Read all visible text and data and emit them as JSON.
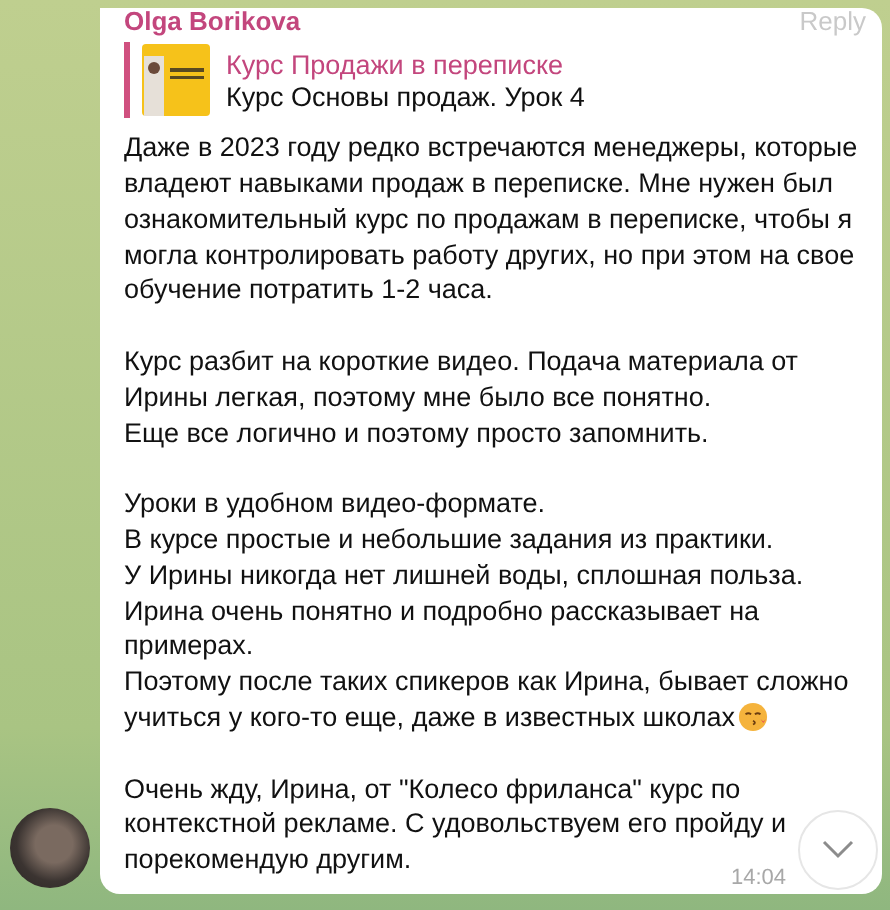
{
  "message": {
    "author": "Olga Borikova",
    "reply_action": "Reply",
    "quote": {
      "title": "Курс Продажи в переписке",
      "text": "Курс Основы продаж. Урок 4"
    },
    "paragraphs": [
      [
        "Даже в 2023 году редко встречаются менеджеры, которые владеют навыками продаж в переписке. Мне нужен был ознакомительный курс по продажам в переписке, чтобы я могла контролировать работу других, но при этом на свое обучение потратить 1-2 часа."
      ],
      [
        "Курс разбит на короткие видео. Подача материала от Ирины легкая, поэтому мне было все понятно.",
        "Еще все логично и поэтому просто запомнить."
      ],
      [
        "Уроки в удобном видео-формате.",
        "В курсе простые и небольшие задания из практики.",
        "У Ирины никогда нет лишней воды, сплошная польза.",
        "Ирина очень понятно и подробно рассказывает на примерах.",
        "Поэтому после таких спикеров как Ирина, бывает сложно",
        "учиться у кого-то еще, даже в известных школах"
      ],
      [
        "Очень жду, Ирина, от \"Колесо фриланса\" курс по контекстной рекламе. С удовольствуем его пройду и порекомендую другим."
      ]
    ],
    "time": "14:04"
  }
}
